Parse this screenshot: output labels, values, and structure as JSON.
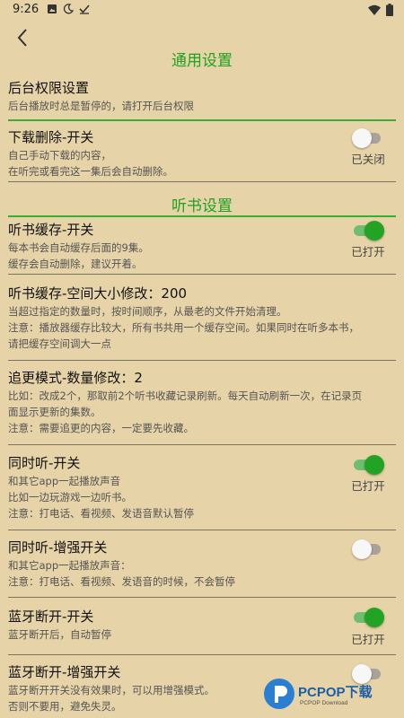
{
  "status_bar": {
    "time": "9:26",
    "left_icons": [
      "photo-icon",
      "moon-icon",
      "check-icon"
    ],
    "right_icons": [
      "wifi-icon",
      "battery-icon"
    ]
  },
  "header": {
    "back_icon": "back-arrow-icon"
  },
  "sections": {
    "general": "通用设置",
    "listen": "听书设置"
  },
  "items": {
    "background": {
      "title": "后台权限设置",
      "desc": [
        "后台播放时总是暂停的，请打开后台权限"
      ]
    },
    "download_delete": {
      "title": "下载删除-开关",
      "desc": [
        "自己手动下载的内容，",
        "在听完或看完这一集后会自动删除。"
      ],
      "state": "已关闭",
      "on": false
    },
    "cache": {
      "title": "听书缓存-开关",
      "desc": [
        "每本书会自动缓存后面的9集。",
        "缓存会自动删除，建议开着。"
      ],
      "state": "已打开",
      "on": true
    },
    "cache_size": {
      "title": "听书缓存-空间大小修改：200",
      "desc": [
        "当超过指定的数量时，按时间顺序，从最老的文件开始清理。",
        "注意：播放器缓存比较大，所有书共用一个缓存空间。如果同时在听多本书，",
        "请把缓存空间调大一点"
      ]
    },
    "update_mode": {
      "title": "追更模式-数量修改：2",
      "desc": [
        "比如：改成2个，那取前2个听书收藏记录刷新。每天自动刷新一次，在记录页",
        "面显示更新的集数。",
        "注意：需要追更的内容，一定要先收藏。"
      ]
    },
    "simultaneous": {
      "title": "同时听-开关",
      "desc": [
        "和其它app一起播放声音",
        "比如一边玩游戏一边听书。",
        "注意：打电话、看视频、发语音默认暂停"
      ],
      "state": "已打开",
      "on": true
    },
    "simultaneous_enhanced": {
      "title": "同时听-增强开关",
      "desc": [
        "和其它app一起播放声音：",
        "注意：打电话、看视频、发语音的时候，不会暂停"
      ],
      "on": false
    },
    "bluetooth": {
      "title": "蓝牙断开-开关",
      "desc": [
        "蓝牙断开后，自动暂停"
      ],
      "state": "已打开",
      "on": true
    },
    "bluetooth_enhanced": {
      "title": "蓝牙断开-增强开关",
      "desc": [
        "蓝牙断开开关没有效果时，可以用增强模式。",
        "否则不要用，避免失灵。"
      ],
      "on": false
    }
  },
  "watermark": {
    "text": "PCPOP下载",
    "sub": "PCPOP Download"
  }
}
